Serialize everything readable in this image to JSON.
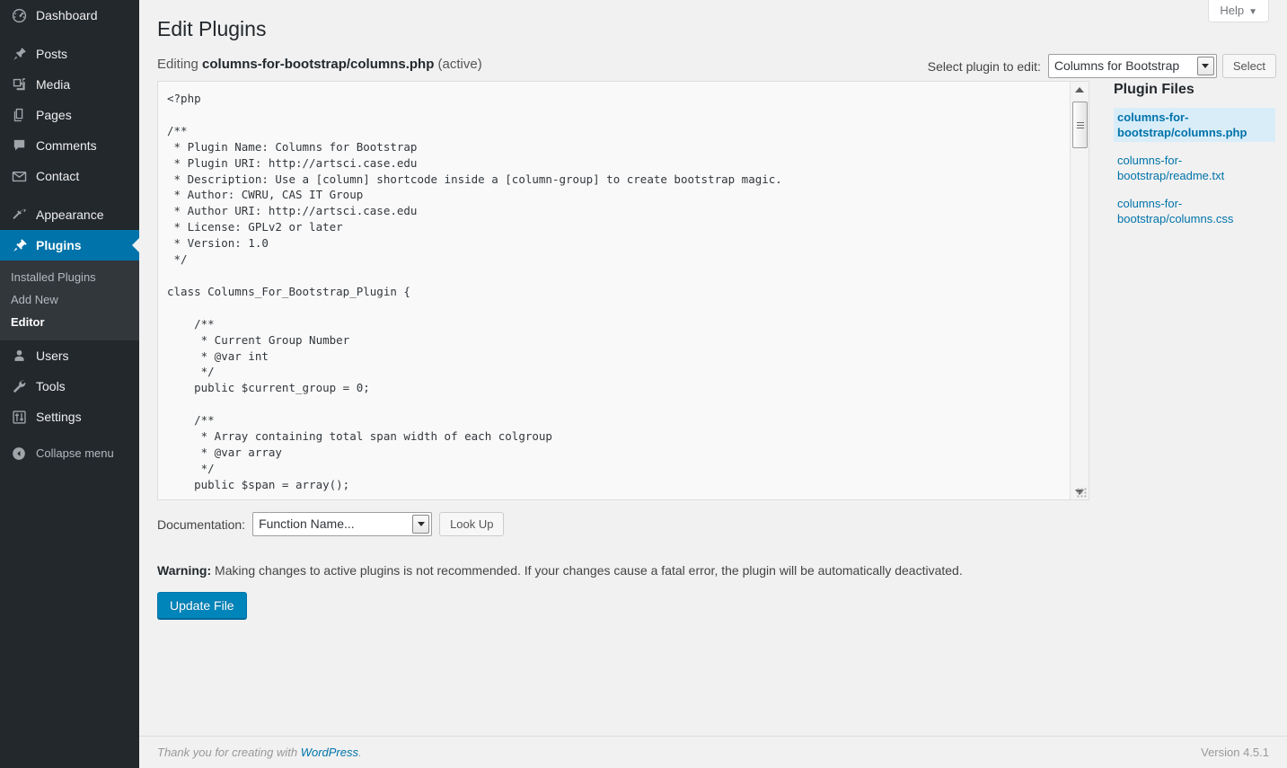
{
  "sidebar": {
    "items": [
      {
        "label": "Dashboard",
        "icon": "dashboard-icon",
        "name": "dashboard"
      },
      {
        "label": "Posts",
        "icon": "pin-icon",
        "name": "posts"
      },
      {
        "label": "Media",
        "icon": "media-icon",
        "name": "media"
      },
      {
        "label": "Pages",
        "icon": "pages-icon",
        "name": "pages"
      },
      {
        "label": "Comments",
        "icon": "comment-icon",
        "name": "comments"
      },
      {
        "label": "Contact",
        "icon": "envelope-icon",
        "name": "contact"
      },
      {
        "label": "Appearance",
        "icon": "paintbrush-icon",
        "name": "appearance"
      },
      {
        "label": "Plugins",
        "icon": "plug-icon",
        "name": "plugins",
        "current": true
      },
      {
        "label": "Users",
        "icon": "user-icon",
        "name": "users"
      },
      {
        "label": "Tools",
        "icon": "wrench-icon",
        "name": "tools"
      },
      {
        "label": "Settings",
        "icon": "settings-icon",
        "name": "settings"
      }
    ],
    "submenu": [
      {
        "label": "Installed Plugins",
        "current": false
      },
      {
        "label": "Add New",
        "current": false
      },
      {
        "label": "Editor",
        "current": true
      }
    ],
    "collapse": {
      "label": "Collapse menu",
      "icon": "collapse-arrow-icon"
    },
    "colors": {
      "background": "#23282d",
      "submenu_background": "#32373c",
      "active": "#0073aa",
      "text": "#eeeeee",
      "muted_text": "#b4b9be"
    }
  },
  "screen_meta": {
    "help_label": "Help",
    "help_caret": "▼"
  },
  "header": {
    "title": "Edit Plugins",
    "editing_prefix": "Editing",
    "editing_file": "columns-for-bootstrap/columns.php",
    "editing_status": "(active)"
  },
  "plugin_selector": {
    "label": "Select plugin to edit:",
    "selected": "Columns for Bootstrap",
    "options": [
      "Columns for Bootstrap"
    ],
    "button_label": "Select"
  },
  "editor": {
    "code": "<?php\n\n/**\n * Plugin Name: Columns for Bootstrap\n * Plugin URI: http://artsci.case.edu\n * Description: Use a [column] shortcode inside a [column-group] to create bootstrap magic.\n * Author: CWRU, CAS IT Group\n * Author URI: http://artsci.case.edu\n * License: GPLv2 or later\n * Version: 1.0\n */\n\nclass Columns_For_Bootstrap_Plugin {\n\n    /**\n     * Current Group Number\n     * @var int\n     */\n    public $current_group = 0;\n\n    /**\n     * Array containing total span width of each colgroup\n     * @var array\n     */\n    public $span = array();\n"
  },
  "plugin_files": {
    "heading": "Plugin Files",
    "files": [
      {
        "label": "columns-for-bootstrap/columns.php",
        "selected": true
      },
      {
        "label": "columns-for-bootstrap/readme.txt",
        "selected": false
      },
      {
        "label": "columns-for-bootstrap/columns.css",
        "selected": false
      }
    ]
  },
  "documentation": {
    "label": "Documentation:",
    "selected": "Function Name...",
    "options": [
      "Function Name..."
    ],
    "lookup_label": "Look Up"
  },
  "warning": {
    "bold": "Warning:",
    "text": " Making changes to active plugins is not recommended. If your changes cause a fatal error, the plugin will be automatically deactivated."
  },
  "submit": {
    "update_label": "Update File"
  },
  "footer": {
    "thanks_prefix": "Thank you for creating with ",
    "wordpress_link": "WordPress",
    "thanks_suffix": ".",
    "version": "Version 4.5.1"
  }
}
